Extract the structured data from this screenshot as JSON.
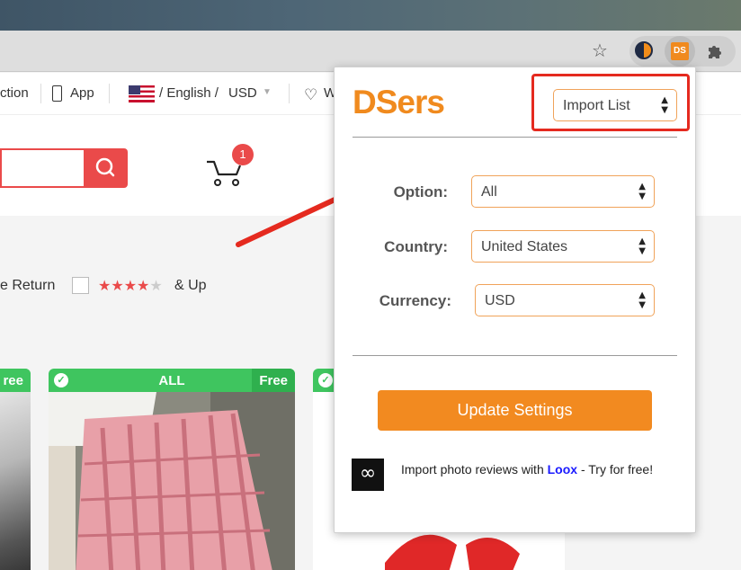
{
  "nav": {
    "collection_fragment": "ction",
    "app_label": "App",
    "language": "/ English /",
    "currency": "USD",
    "wishlist_fragment": "W"
  },
  "cart": {
    "count": "1"
  },
  "filters": {
    "return_fragment": "e Return",
    "rating_stars": "★★★★",
    "rating_empty_star": "★",
    "rating_suffix": "& Up"
  },
  "cards": [
    {
      "free": "ree"
    },
    {
      "all": "ALL",
      "free": "Free"
    },
    {
      "free": ""
    }
  ],
  "popup": {
    "logo": "DSers",
    "import_select": "Import List",
    "option_label": "Option:",
    "option_value": "All",
    "country_label": "Country:",
    "country_value": "United States",
    "currency_label": "Currency:",
    "currency_value": "USD",
    "update_button": "Update Settings",
    "loox_prefix": "Import photo reviews with ",
    "loox_brand": "Loox",
    "loox_suffix": " - Try for free!"
  },
  "extensions": {
    "ds_label": "DS"
  },
  "colors": {
    "brand_orange": "#f28a20",
    "highlight_red": "#e52a1f",
    "free_green": "#3fc55f"
  }
}
